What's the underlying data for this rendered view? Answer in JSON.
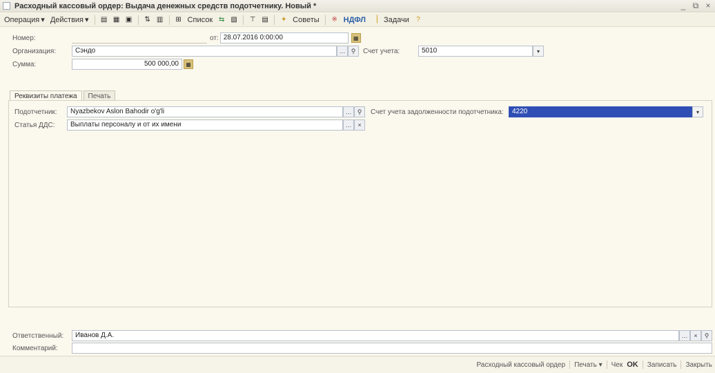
{
  "window": {
    "title": "Расходный кассовый ордер: Выдача денежных средств подотчетнику. Новый *",
    "controls": [
      "_",
      "⧉",
      "×"
    ]
  },
  "toolbar": {
    "operation_label": "Операция",
    "actions_label": "Действия",
    "list_label": "Список",
    "advice_label": "Советы",
    "ndfl_label": "НДФЛ",
    "tasks_label": "Задачи"
  },
  "header": {
    "number_label": "Номер:",
    "number_value": "",
    "date_prefix": "от:",
    "date_value": "28.07.2016 0:00:00",
    "org_label": "Организация:",
    "org_value": "Сэндо",
    "account_label": "Счет учета:",
    "account_value": "5010",
    "sum_label": "Сумма:",
    "sum_value": "500 000,00"
  },
  "tabs": [
    {
      "label": "Реквизиты платежа",
      "active": true
    },
    {
      "label": "Печать",
      "active": false
    }
  ],
  "payment": {
    "accountable_label": "Подотчетник:",
    "accountable_value": "Nyazbekov Aslon Bahodir o'g'li",
    "dds_label": "Статья ДДС:",
    "dds_value": "Выплаты персоналу и от их имени",
    "debt_account_label": "Счет учета задолженности подотчетника:",
    "debt_account_value": "4220"
  },
  "footer": {
    "responsible_label": "Ответственный:",
    "responsible_value": "Иванов Д.А.",
    "comment_label": "Комментарий:",
    "comment_value": ""
  },
  "status_bar": {
    "doc_type": "Расходный кассовый ордер",
    "print_label": "Печать",
    "check_label": "Чек",
    "ok_label": "OK",
    "save_label": "Записать",
    "close_label": "Закрыть"
  },
  "colors": {
    "selection": "#2f4fb4",
    "background": "#fbf8ee"
  }
}
